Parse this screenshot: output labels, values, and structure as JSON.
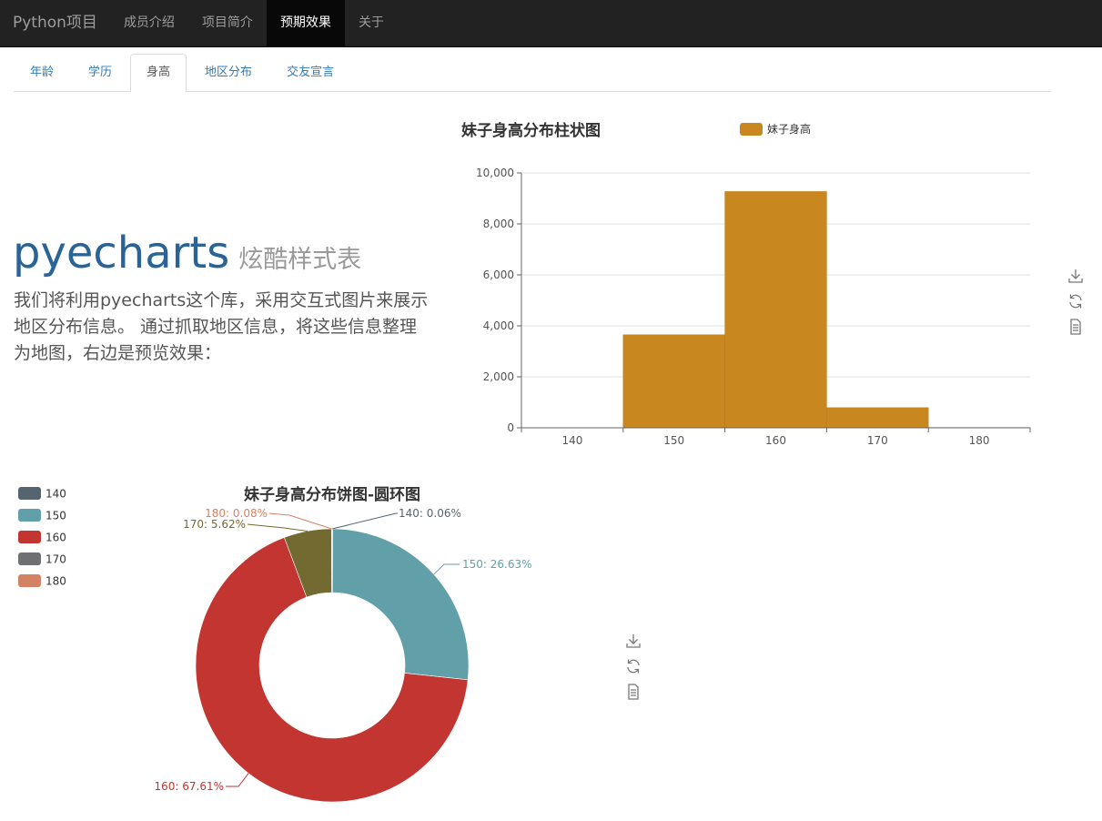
{
  "navbar": {
    "brand": "Python项目",
    "items": [
      {
        "label": "成员介绍",
        "active": false
      },
      {
        "label": "项目简介",
        "active": false
      },
      {
        "label": "预期效果",
        "active": true
      },
      {
        "label": "关于",
        "active": false
      }
    ]
  },
  "tabs": [
    {
      "label": "年龄",
      "active": false
    },
    {
      "label": "学历",
      "active": false
    },
    {
      "label": "身高",
      "active": true
    },
    {
      "label": "地区分布",
      "active": false
    },
    {
      "label": "交友宣言",
      "active": false
    }
  ],
  "jumbotron": {
    "title": "pyecharts",
    "subtitle": "炫酷样式表",
    "text": "我们将利用pyecharts这个库，采用交互式图片来展示地区分布信息。 通过抓取地区信息，将这些信息整理为地图，右边是预览效果："
  },
  "toolbox_icons": [
    "download-icon",
    "refresh-icon",
    "data-view-icon"
  ],
  "chart_data": [
    {
      "type": "bar",
      "title": "妹子身高分布柱状图",
      "categories": [
        "140",
        "150",
        "160",
        "170",
        "180"
      ],
      "series": [
        {
          "name": "妹子身高",
          "values": [
            9,
            3650,
            9270,
            790,
            12
          ],
          "color": "#c9871f"
        }
      ],
      "ylim": [
        0,
        10000
      ],
      "yticks": [
        "0",
        "2,000",
        "4,000",
        "6,000",
        "8,000",
        "10,000"
      ],
      "legend": "top-center",
      "grid": true
    },
    {
      "type": "pie",
      "title": "妹子身高分布饼图-圆环图",
      "labels": [
        "140",
        "150",
        "160",
        "170",
        "180"
      ],
      "values": [
        0.06,
        26.63,
        67.61,
        5.62,
        0.08
      ],
      "slice_labels": [
        "140: 0.06%",
        "150: 26.63%",
        "160: 67.61%",
        "170: 5.62%",
        "180: 0.08%"
      ],
      "colors": [
        "#546570",
        "#61a0a8",
        "#c23531",
        "#6e7074",
        "#d48265"
      ],
      "slice_colors": [
        "#546570",
        "#61a0a8",
        "#c23531",
        "#726a31",
        "#d48265"
      ],
      "legend": "top-left"
    }
  ]
}
